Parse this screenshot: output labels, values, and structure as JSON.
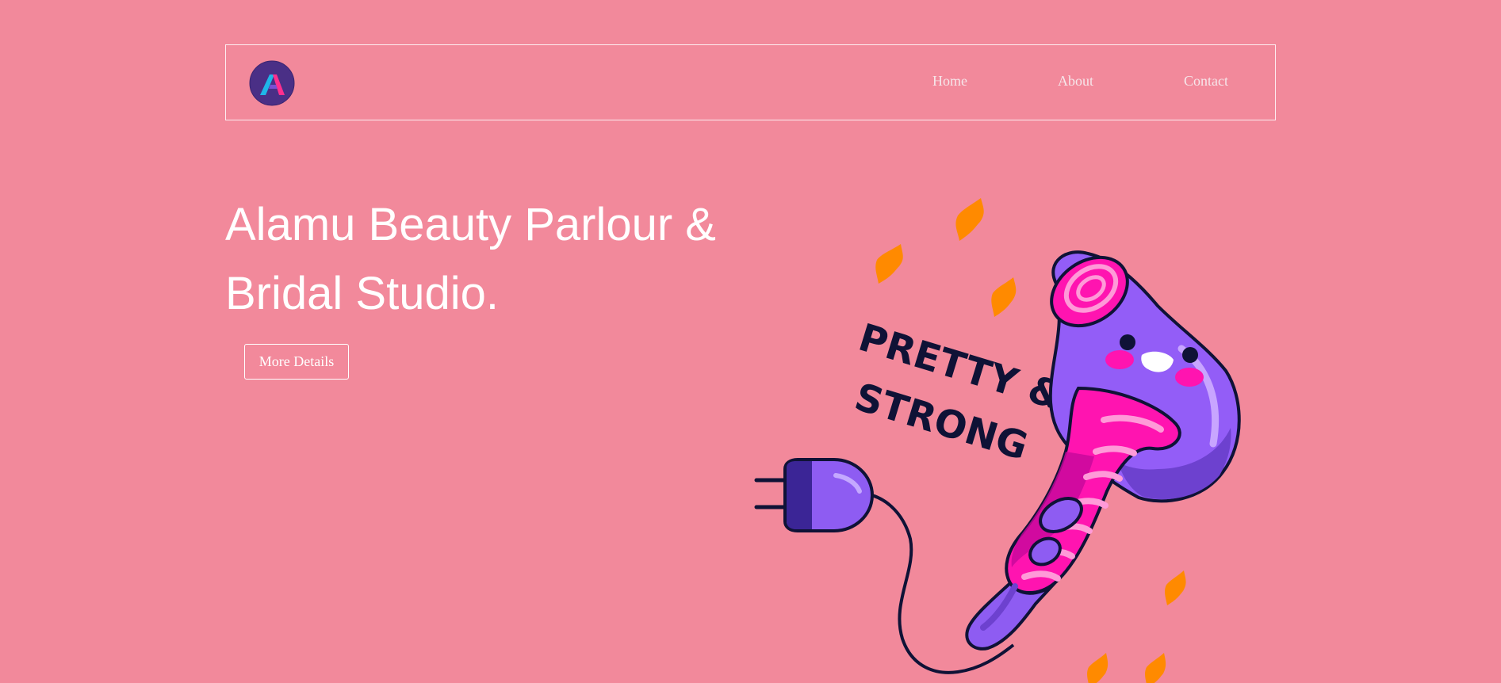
{
  "nav": {
    "logo_icon": "brand-a-logo",
    "links": [
      "Home",
      "About",
      "Contact"
    ]
  },
  "hero": {
    "title_line1": "Alamu Beauty Parlour &",
    "title_line2": "Bridal Studio.",
    "button_label": "More Details"
  },
  "illustration": {
    "caption_line1": "PRETTY &",
    "caption_line2": "STRONG",
    "icon": "hair-dryer-illustration"
  },
  "colors": {
    "background": "#f2899b",
    "logo_circle": "#4a2f86",
    "dryer_purple": "#935df7",
    "dryer_pink": "#ff14b0",
    "sparkle": "#ff8a00",
    "outline": "#0f1236"
  }
}
